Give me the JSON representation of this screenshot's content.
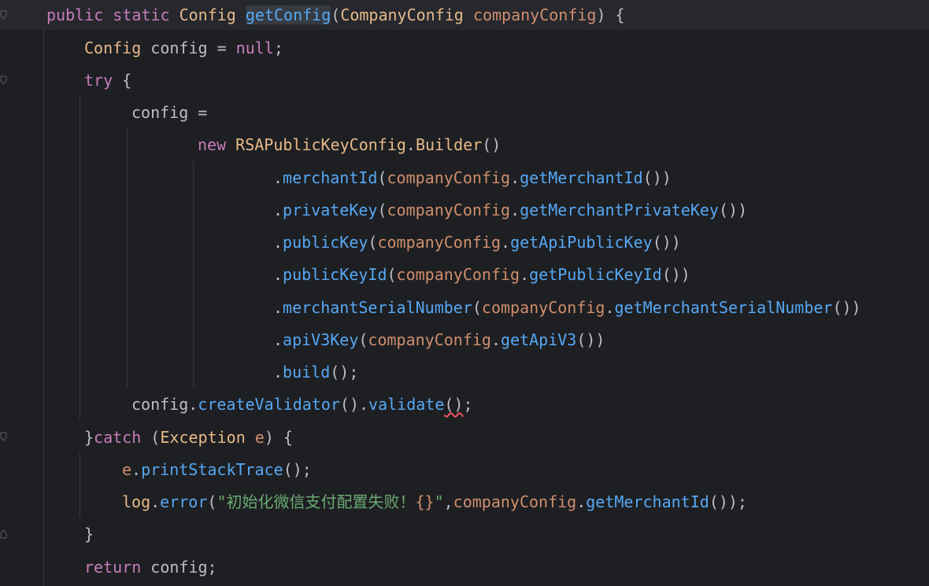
{
  "editor": {
    "colors": {
      "background": "#1e1f22",
      "current_line": "#26282e",
      "keyword": "#cf8e6d",
      "function": "#56a8f5",
      "default_text": "#bcbec4",
      "string": "#6aab73"
    },
    "lines": [
      {
        "tokens": [
          "public",
          " ",
          "static",
          " ",
          "Config",
          " ",
          "getConfig",
          "(",
          "CompanyConfig",
          " ",
          "companyConfig",
          ") {"
        ]
      },
      {
        "tokens": [
          "Config",
          " config = ",
          "null",
          ";"
        ]
      },
      {
        "tokens": [
          "try",
          " {"
        ]
      },
      {
        "tokens": [
          "config ="
        ]
      },
      {
        "tokens": [
          "new",
          " ",
          "RSAPublicKeyConfig",
          ".",
          "Builder",
          "()"
        ]
      },
      {
        "tokens": [
          ".",
          "merchantId",
          "(",
          "companyConfig",
          ".",
          "getMerchantId",
          "())"
        ]
      },
      {
        "tokens": [
          ".",
          "privateKey",
          "(",
          "companyConfig",
          ".",
          "getMerchantPrivateKey",
          "())"
        ]
      },
      {
        "tokens": [
          ".",
          "publicKey",
          "(",
          "companyConfig",
          ".",
          "getApiPublicKey",
          "())"
        ]
      },
      {
        "tokens": [
          ".",
          "publicKeyId",
          "(",
          "companyConfig",
          ".",
          "getPublicKeyId",
          "())"
        ]
      },
      {
        "tokens": [
          ".",
          "merchantSerialNumber",
          "(",
          "companyConfig",
          ".",
          "getMerchantSerialNumber",
          "())"
        ]
      },
      {
        "tokens": [
          ".",
          "apiV3Key",
          "(",
          "companyConfig",
          ".",
          "getApiV3",
          "())"
        ]
      },
      {
        "tokens": [
          ".",
          "build",
          "();"
        ]
      },
      {
        "tokens": [
          "config",
          ".",
          "createValidator",
          "().",
          "validate",
          "()",
          ";"
        ]
      },
      {
        "tokens": [
          "}",
          "catch",
          " (",
          "Exception",
          " ",
          "e",
          ") {"
        ]
      },
      {
        "tokens": [
          "e",
          ".",
          "printStackTrace",
          "();"
        ]
      },
      {
        "tokens": [
          "log",
          ".",
          "error",
          "(",
          "\"初始化微信支付配置失败！",
          "{}",
          "\"",
          ",",
          "companyConfig",
          ".",
          "getMerchantId",
          "());"
        ]
      },
      {
        "tokens": [
          "}"
        ]
      },
      {
        "tokens": [
          "return",
          " config;"
        ]
      }
    ]
  }
}
